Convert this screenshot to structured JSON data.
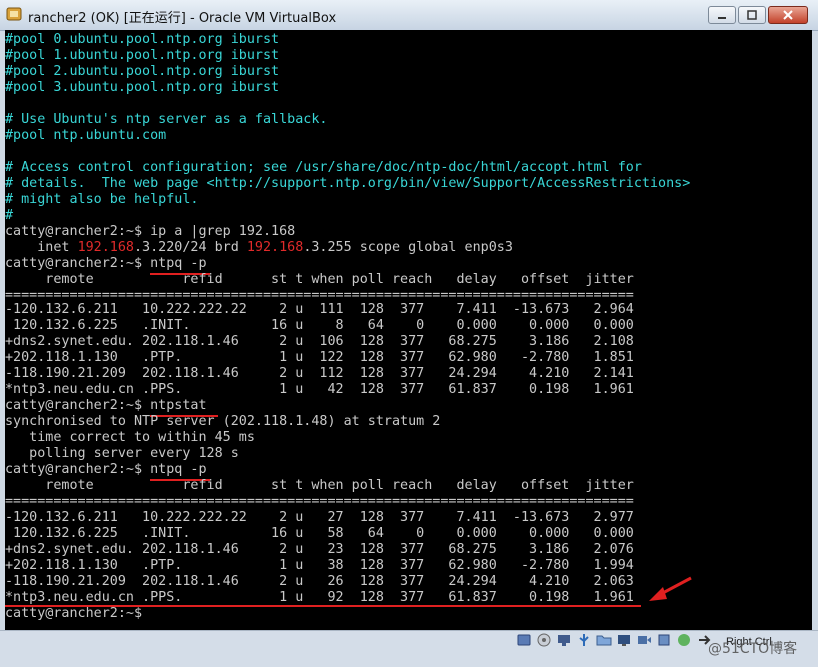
{
  "window": {
    "title": "rancher2 (OK) [正在运行] - Oracle VM VirtualBox",
    "buttons": {
      "minimize": "minimize",
      "maximize": "maximize",
      "close": "close"
    }
  },
  "terminal": {
    "config_lines": [
      "#pool 0.ubuntu.pool.ntp.org iburst",
      "#pool 1.ubuntu.pool.ntp.org iburst",
      "#pool 2.ubuntu.pool.ntp.org iburst",
      "#pool 3.ubuntu.pool.ntp.org iburst",
      "",
      "# Use Ubuntu's ntp server as a fallback.",
      "#pool ntp.ubuntu.com",
      "",
      "# Access control configuration; see /usr/share/doc/ntp-doc/html/accopt.html for",
      "# details.  The web page <http://support.ntp.org/bin/view/Support/AccessRestrictions>",
      "# might also be helpful.",
      "#"
    ],
    "prompt": "catty@rancher2:~$ ",
    "cmd_ip": "ip a |grep 192.168",
    "ip_output": {
      "prefix": "    inet ",
      "hl1": "192.168",
      "mid": ".3.220/24 brd ",
      "hl2": "192.168",
      "suffix": ".3.255 scope global enp0s3"
    },
    "cmd_ntpq": "ntpq -p",
    "cmd_ntpstat": "ntpstat",
    "ntpq_header": "     remote           refid      st t when poll reach   delay   offset  jitter",
    "rule": "==============================================================================",
    "table1": [
      "-120.132.6.211   10.222.222.22    2 u  111  128  377    7.411  -13.673   2.964",
      " 120.132.6.225   .INIT.          16 u    8   64    0    0.000    0.000   0.000",
      "+dns2.synet.edu. 202.118.1.46     2 u  106  128  377   68.275    3.186   2.108",
      "+202.118.1.130   .PTP.            1 u  122  128  377   62.980   -2.780   1.851",
      "-118.190.21.209  202.118.1.46     2 u  112  128  377   24.294    4.210   2.141",
      "*ntp3.neu.edu.cn .PPS.            1 u   42  128  377   61.837    0.198   1.961"
    ],
    "ntpstat_output": [
      "synchronised to NTP server (202.118.1.48) at stratum 2",
      "   time correct to within 45 ms",
      "   polling server every 128 s"
    ],
    "table2": [
      "-120.132.6.211   10.222.222.22    2 u   27  128  377    7.411  -13.673   2.977",
      " 120.132.6.225   .INIT.          16 u   58   64    0    0.000    0.000   0.000",
      "+dns2.synet.edu. 202.118.1.46     2 u   23  128  377   68.275    3.186   2.076",
      "+202.118.1.130   .PTP.            1 u   38  128  377   62.980   -2.780   1.994",
      "-118.190.21.209  202.118.1.46     2 u   26  128  377   24.294    4.210   2.063",
      "*ntp3.neu.edu.cn .PPS.            1 u   92  128  377   61.837    0.198   1.961"
    ],
    "final_prompt": "catty@rancher2:~$"
  },
  "statusbar": {
    "host_key": "Right Ctrl",
    "watermark": "@51CTO博客"
  },
  "colors": {
    "comment": "#39d6d6",
    "text": "#c9c9c9",
    "highlight": "#e02a2a"
  }
}
